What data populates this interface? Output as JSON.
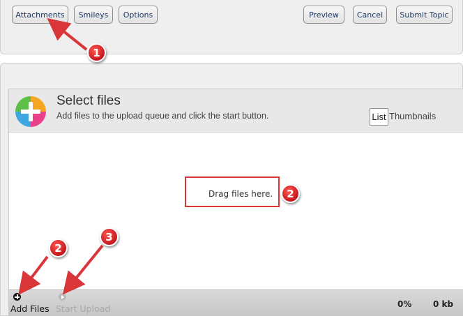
{
  "toolbar": {
    "attachments_label": "Attachments",
    "smileys_label": "Smileys",
    "options_label": "Options",
    "preview_label": "Preview",
    "cancel_label": "Cancel",
    "submit_label": "Submit Topic"
  },
  "uploader": {
    "title": "Select files",
    "subtitle": "Add files to the upload queue and click the start button.",
    "view_list_label": "List",
    "view_thumbnails_label": "Thumbnails",
    "drop_text": "Drag files here.",
    "add_files_label": "Add Files",
    "start_upload_label": "Start Upload",
    "percent": "0%",
    "size": "0 kb"
  },
  "annotations": {
    "badge_1": "1",
    "badge_2_drop": "2",
    "badge_2_add": "2",
    "badge_3": "3",
    "accent_color": "#d9363a"
  },
  "icons": {
    "add_files": "plus-circle-icon",
    "start_upload": "arrow-circle-icon",
    "select_files": "colorful-plus-icon"
  }
}
